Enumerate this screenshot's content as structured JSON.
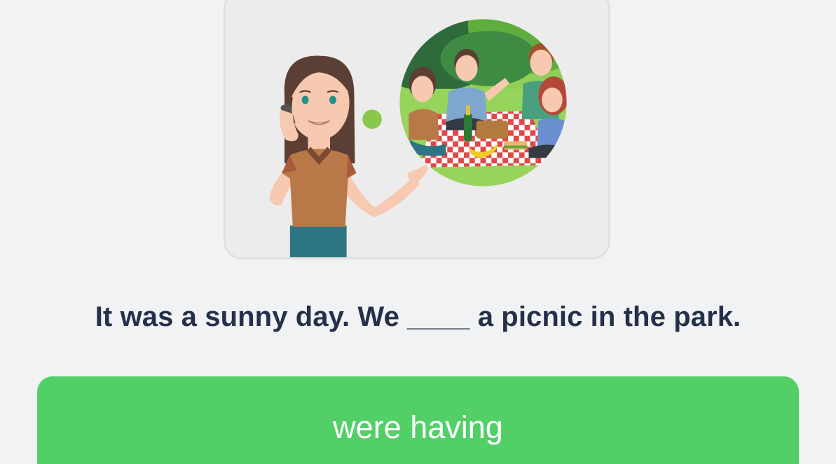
{
  "exercise": {
    "illustration": {
      "icon": "woman-on-phone-thinking-of-picnic-illustration"
    },
    "prompt": "It was a sunny day. We ____ a picnic in the park.",
    "options": [
      {
        "label": "were having"
      }
    ]
  },
  "colors": {
    "background": "#f1f2f4",
    "card": "#ececec",
    "text": "#25304a",
    "answer_button": "#52cf67",
    "answer_text": "#ffffff"
  }
}
